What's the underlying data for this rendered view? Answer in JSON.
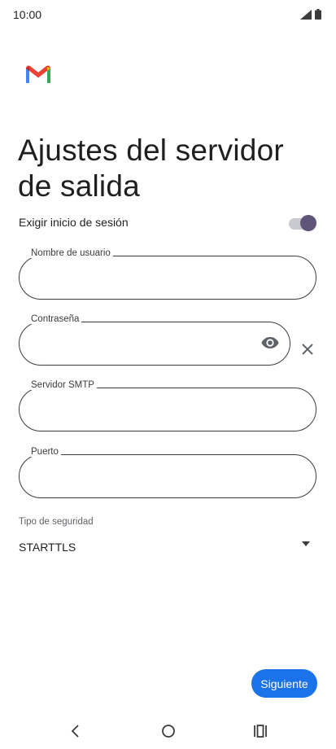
{
  "status_bar": {
    "time": "10:00"
  },
  "title": "Ajustes del servidor de salida",
  "require_signin": {
    "label": "Exigir inicio de sesión",
    "enabled": true
  },
  "fields": {
    "username": {
      "label": "Nombre de usuario",
      "value": ""
    },
    "password": {
      "label": "Contraseña",
      "value": ""
    },
    "smtp_server": {
      "label": "Servidor SMTP",
      "value": ""
    },
    "port": {
      "label": "Puerto",
      "value": ""
    }
  },
  "security": {
    "label": "Tipo de seguridad",
    "value": "STARTTLS"
  },
  "next_button": {
    "label": "Siguiente"
  },
  "colors": {
    "accent": "#1a73e8",
    "toggle_thumb": "#5e5578"
  },
  "icons": [
    "signal-icon",
    "battery-icon",
    "gmail-logo",
    "eye-icon",
    "close-icon",
    "dropdown-arrow-icon",
    "back-icon",
    "home-icon",
    "recents-icon"
  ]
}
